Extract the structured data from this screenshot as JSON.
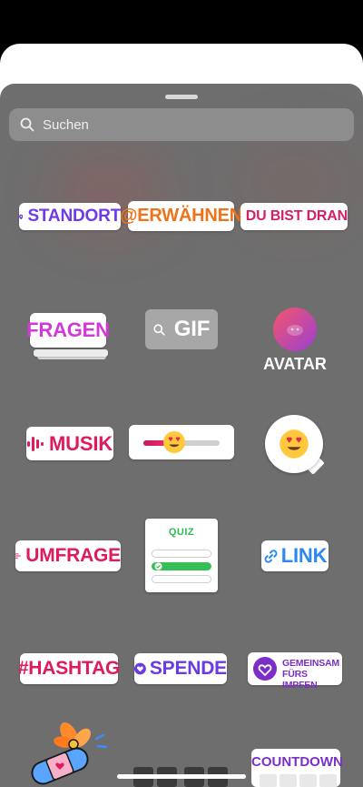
{
  "search": {
    "placeholder": "Suchen"
  },
  "stickers": {
    "standort": "STANDORT",
    "erwaehnen": "@ERWÄHNEN",
    "du_bist_dran": "DU BIST DRAN",
    "fragen": "FRAGEN",
    "gif": "GIF",
    "avatar": "AVATAR",
    "musik": "MUSIK",
    "umfrage": "UMFRAGE",
    "quiz": "QUIZ",
    "link": "LINK",
    "hashtag": "#HASHTAG",
    "spende": "SPENDE",
    "impfen_line1": "GEMEINSAM",
    "impfen_line2": "FÜRS IMPFEN",
    "countdown": "COUNTDOWN"
  },
  "slider": {
    "level": 0.4
  },
  "icons": [
    "location-pin-icon",
    "camera-icon",
    "search-icon",
    "music-bars-icon",
    "heart-eyes-emoji-icon",
    "poll-lines-icon",
    "link-icon",
    "heart-icon",
    "heart-shield-icon",
    "band-aid-icon",
    "flower-icon"
  ],
  "colors": {
    "tray": "#6e6e6e",
    "standort": "#6f3be8",
    "erwaehnen": "#f07219",
    "du_bist_dran": "#d61f69",
    "fragen": "#d23ad6",
    "musik": "#e01a5c",
    "link": "#2d88f0",
    "quiz": "#2dbb52",
    "spende": "#6a3be0",
    "countdown": "#7b2fc7"
  }
}
